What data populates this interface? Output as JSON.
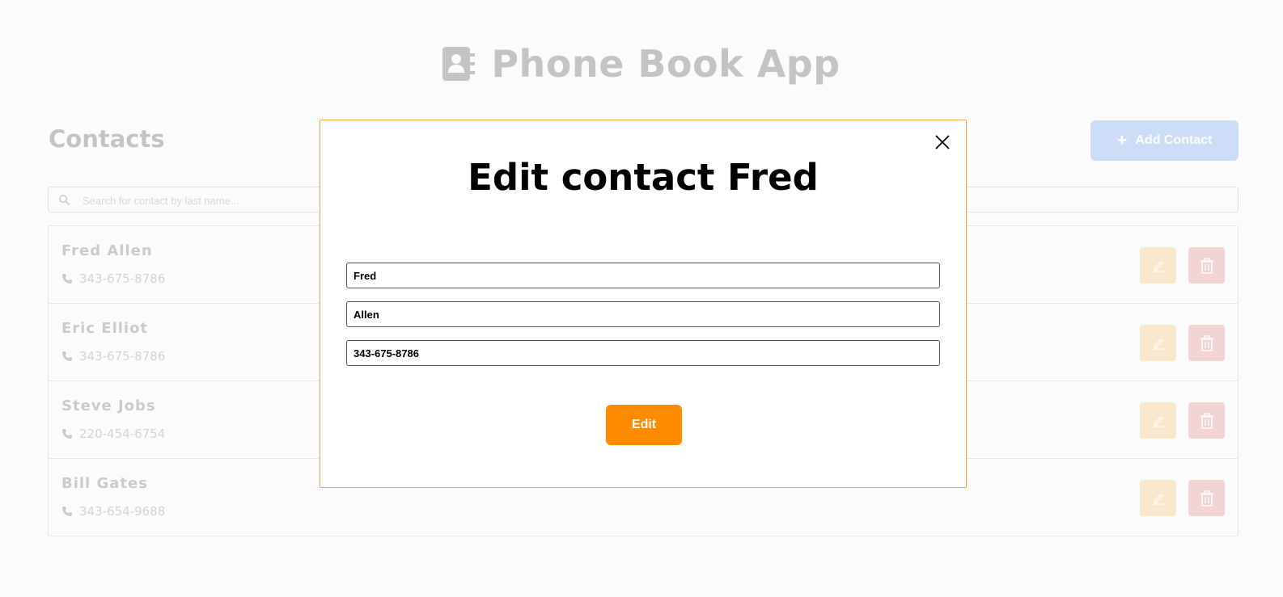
{
  "app": {
    "title": "Phone Book App",
    "icon": "address-book-icon",
    "contacts_heading": "Contacts",
    "add_button_label": "Add Contact",
    "search_placeholder": "Search for contact by last name..."
  },
  "contacts": [
    {
      "name": "Fred Allen",
      "phone": "343-675-8786"
    },
    {
      "name": "Eric Elliot",
      "phone": "343-675-8786"
    },
    {
      "name": "Steve Jobs",
      "phone": "220-454-6754"
    },
    {
      "name": "Bill Gates",
      "phone": "343-654-9688"
    }
  ],
  "modal": {
    "title": "Edit contact Fred",
    "first_name": "Fred",
    "last_name": "Allen",
    "phone": "343-675-8786",
    "submit_label": "Edit",
    "close_icon": "close-icon"
  },
  "colors": {
    "accent_orange": "#ff8c00",
    "primary_blue": "#3b82f6",
    "danger_red": "#e05a5a",
    "edit_orange": "#fbb040"
  }
}
